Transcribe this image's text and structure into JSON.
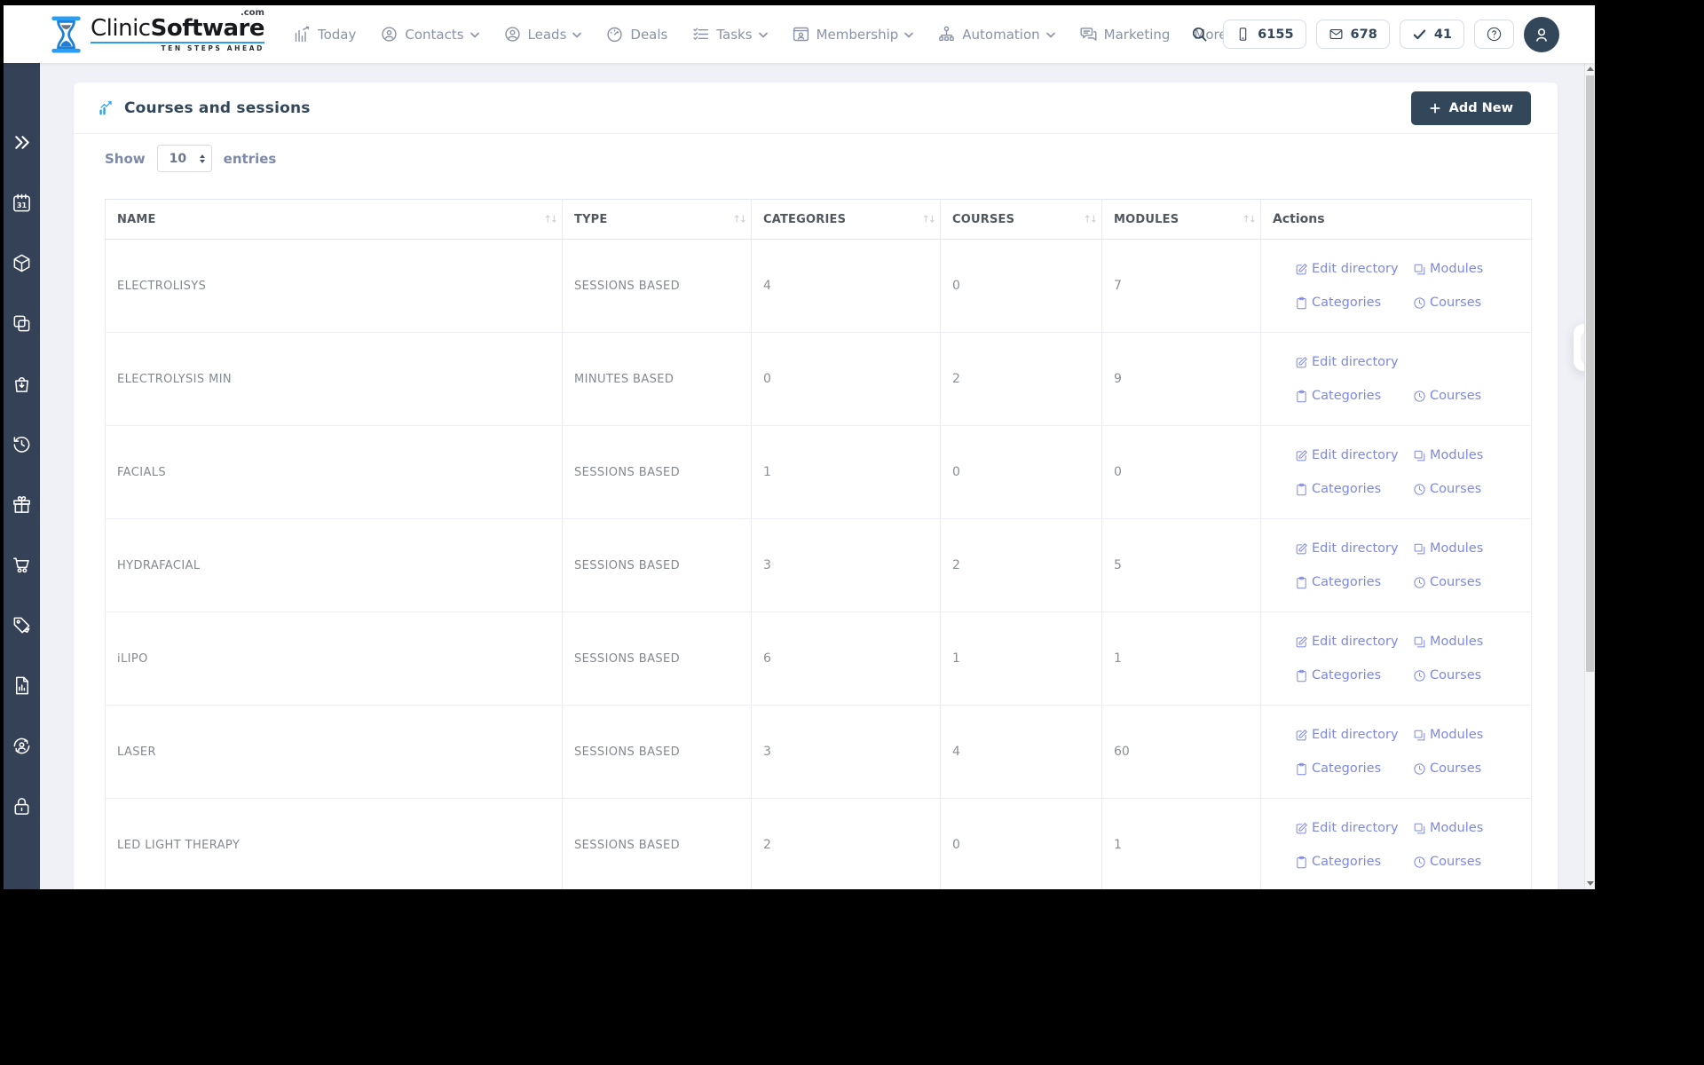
{
  "colors": {
    "accent_blue": "#2e9fe8",
    "navy": "#33475b",
    "link_purple": "#7e88e0",
    "cart_amber": "#f0b33e",
    "sidebar_bg": "#344156"
  },
  "navbar": {
    "logo": {
      "name_light": "Clinic",
      "name_bold": "Software",
      "suffix": ".com",
      "tagline": "TEN STEPS AHEAD"
    },
    "items": [
      {
        "label": "Today",
        "icon": "today-icon",
        "dropdown": false
      },
      {
        "label": "Contacts",
        "icon": "contacts-icon",
        "dropdown": true
      },
      {
        "label": "Leads",
        "icon": "leads-icon",
        "dropdown": true
      },
      {
        "label": "Deals",
        "icon": "deals-icon",
        "dropdown": false
      },
      {
        "label": "Tasks",
        "icon": "tasks-icon",
        "dropdown": true
      },
      {
        "label": "Membership",
        "icon": "membership-icon",
        "dropdown": true
      },
      {
        "label": "Automation",
        "icon": "automation-icon",
        "dropdown": true
      },
      {
        "label": "Marketing",
        "icon": "marketing-icon",
        "dropdown": false
      },
      {
        "label": "More",
        "icon": null,
        "dropdown": true
      }
    ],
    "counters": [
      {
        "icon": "phone-icon",
        "value": "6155"
      },
      {
        "icon": "mail-icon",
        "value": "678"
      },
      {
        "icon": "check-icon",
        "value": "41"
      }
    ]
  },
  "sidebar": {
    "items": [
      {
        "icon": "double-chevron-right-icon"
      },
      {
        "icon": "calendar-icon"
      },
      {
        "icon": "cube-icon"
      },
      {
        "icon": "copy-icon"
      },
      {
        "icon": "bag-arrow-icon"
      },
      {
        "icon": "history-icon"
      },
      {
        "icon": "gift-icon"
      },
      {
        "icon": "cart-icon"
      },
      {
        "icon": "price-tag-icon"
      },
      {
        "icon": "report-icon"
      },
      {
        "icon": "user-sync-icon"
      },
      {
        "icon": "lock-icon"
      }
    ]
  },
  "page": {
    "title": "Courses and sessions",
    "add_new_label": "Add New",
    "show_label": "Show",
    "entries_label": "entries",
    "page_size": "10"
  },
  "table": {
    "columns": [
      {
        "label": "NAME",
        "sortable": true
      },
      {
        "label": "TYPE",
        "sortable": true
      },
      {
        "label": "CATEGORIES",
        "sortable": true
      },
      {
        "label": "COURSES",
        "sortable": true
      },
      {
        "label": "MODULES",
        "sortable": true
      },
      {
        "label": "Actions",
        "sortable": false
      }
    ],
    "rows": [
      {
        "name": "ELECTROLISYS",
        "type": "SESSIONS BASED",
        "categories": "4",
        "courses": "0",
        "modules": "7",
        "actions": [
          "Edit directory",
          "Modules",
          "Categories",
          "Courses"
        ]
      },
      {
        "name": "ELECTROLYSIS MIN",
        "type": "MINUTES BASED",
        "categories": "0",
        "courses": "2",
        "modules": "9",
        "actions": [
          "Edit directory",
          "Categories",
          "Courses"
        ]
      },
      {
        "name": "FACIALS",
        "type": "SESSIONS BASED",
        "categories": "1",
        "courses": "0",
        "modules": "0",
        "actions": [
          "Edit directory",
          "Modules",
          "Categories",
          "Courses"
        ]
      },
      {
        "name": "HYDRAFACIAL",
        "type": "SESSIONS BASED",
        "categories": "3",
        "courses": "2",
        "modules": "5",
        "actions": [
          "Edit directory",
          "Modules",
          "Categories",
          "Courses"
        ]
      },
      {
        "name": "iLIPO",
        "type": "SESSIONS BASED",
        "categories": "6",
        "courses": "1",
        "modules": "1",
        "actions": [
          "Edit directory",
          "Modules",
          "Categories",
          "Courses"
        ]
      },
      {
        "name": "LASER",
        "type": "SESSIONS BASED",
        "categories": "3",
        "courses": "4",
        "modules": "60",
        "actions": [
          "Edit directory",
          "Modules",
          "Categories",
          "Courses"
        ]
      },
      {
        "name": "LED LIGHT THERAPY",
        "type": "SESSIONS BASED",
        "categories": "2",
        "courses": "0",
        "modules": "1",
        "actions": [
          "Edit directory",
          "Modules",
          "Categories",
          "Courses"
        ]
      }
    ]
  }
}
